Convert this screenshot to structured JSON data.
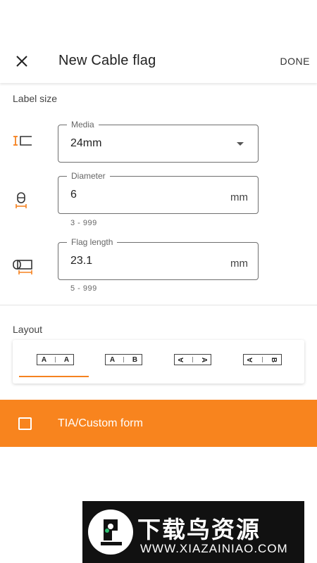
{
  "header": {
    "title": "New Cable flag",
    "done_label": "DONE"
  },
  "label_size": {
    "section_label": "Label size",
    "media": {
      "label": "Media",
      "value": "24mm"
    },
    "diameter": {
      "label": "Diameter",
      "value": "6",
      "unit": "mm",
      "helper": "3 - 999"
    },
    "flag_length": {
      "label": "Flag length",
      "value": "23.1",
      "unit": "mm",
      "helper": "5 - 999"
    }
  },
  "layout": {
    "section_label": "Layout",
    "options": [
      {
        "left": "A",
        "right": "A",
        "selected": true
      },
      {
        "left": "A",
        "right": "B",
        "selected": false
      },
      {
        "left": "A",
        "right": "A",
        "rotated": true,
        "selected": false
      },
      {
        "left": "A",
        "right": "B",
        "rotated": true,
        "selected": false
      }
    ]
  },
  "tia": {
    "label": "TIA/Custom form",
    "checked": false
  },
  "watermark": {
    "title": "下载鸟资源",
    "url": "WWW.XIAZAINIAO.COM"
  },
  "colors": {
    "accent": "#f58220",
    "banner": "#f8841e"
  }
}
